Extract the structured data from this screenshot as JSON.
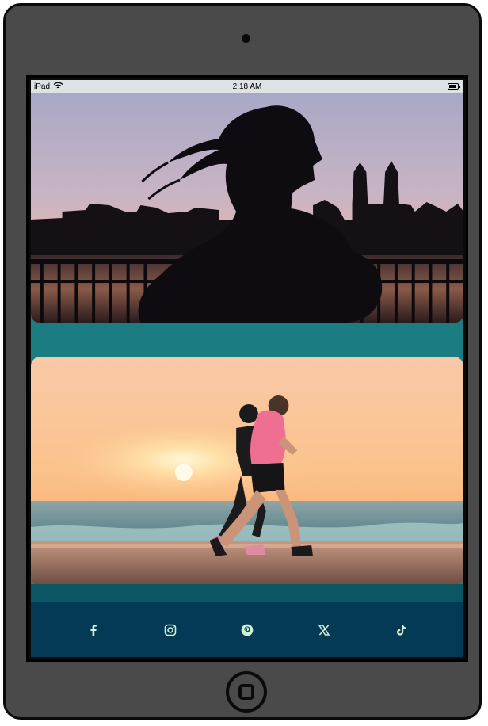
{
  "statusbar": {
    "device": "iPad",
    "time": "2:18 AM",
    "wifi_icon": "wifi-icon",
    "battery_icon": "battery-icon"
  },
  "photos": [
    {
      "name": "runner-silhouette-city-photo",
      "description_icon": "image"
    },
    {
      "name": "beach-runners-sunset-photo",
      "description_icon": "image"
    }
  ],
  "footer": {
    "social_links": [
      {
        "icon": "facebook-icon"
      },
      {
        "icon": "instagram-icon"
      },
      {
        "icon": "pinterest-icon"
      },
      {
        "icon": "x-twitter-icon"
      },
      {
        "icon": "tiktok-icon"
      }
    ],
    "icon_color": "#cff3d4"
  },
  "colors": {
    "teal": "#1b7c82",
    "dark_teal": "#0a5663",
    "navy": "#043a55",
    "device": "#4a4a4a"
  }
}
